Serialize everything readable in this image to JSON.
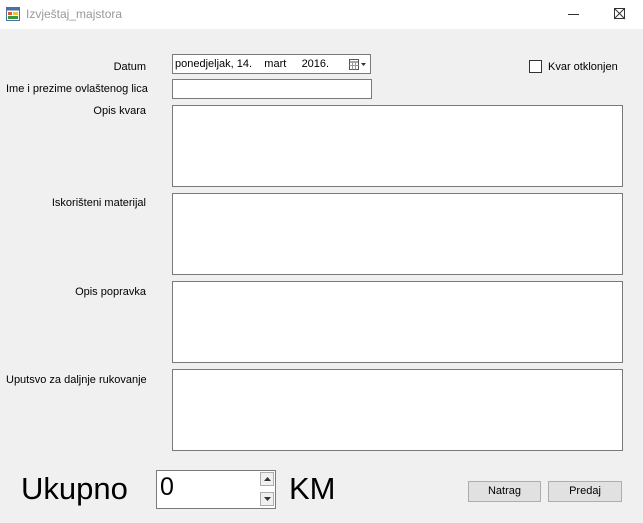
{
  "window": {
    "title": "Izvještaj_majstora",
    "minimize_icon": "minimize-icon",
    "maximize_icon": "maximize-icon",
    "close_icon": "close-icon"
  },
  "form": {
    "datum_label": "Datum",
    "datum_value": "ponedjeljak, 14.    mart     2016.",
    "kvar_checkbox_label": "Kvar otklonjen",
    "kvar_checked": false,
    "ime_label": "Ime i prezime ovlaštenog lica",
    "ime_value": "",
    "opis_kvara_label": "Opis kvara",
    "opis_kvara_value": "",
    "materijal_label": "Iskorišteni materijal",
    "materijal_value": "",
    "opis_popravka_label": "Opis popravka",
    "opis_popravka_value": "",
    "uputstvo_label": "Uputsvo za daljnje rukovanje",
    "uputstvo_value": ""
  },
  "footer": {
    "ukupno_label": "Ukupno",
    "amount_value": "0",
    "currency": "KM",
    "natrag_button": "Natrag",
    "predaj_button": "Predaj"
  }
}
